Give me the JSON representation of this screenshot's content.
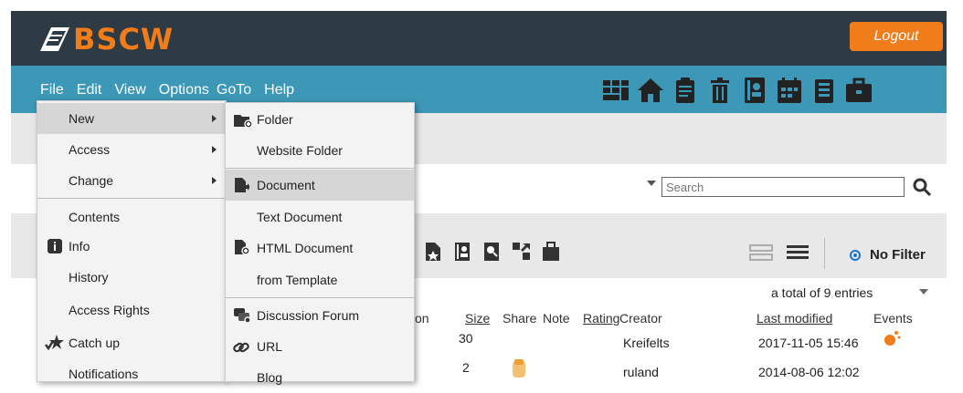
{
  "header": {
    "logo_text": "BSCW",
    "logout_label": "Logout"
  },
  "menubar": {
    "items": [
      "File",
      "Edit",
      "View",
      "Options",
      "GoTo",
      "Help"
    ]
  },
  "toolbar_icons": [
    "grid-icon",
    "home-icon",
    "clipboard-icon",
    "trash-icon",
    "contacts-icon",
    "calendar-icon",
    "tasks-icon",
    "briefcase-icon"
  ],
  "search": {
    "placeholder": "Search"
  },
  "filter": {
    "label": "No Filter"
  },
  "list": {
    "total": "a total of 9 entries",
    "headers": {
      "action": "on",
      "size": "Size",
      "share": "Share",
      "note": "Note",
      "rating": "Rating",
      "creator": "Creator",
      "modified": "Last modified",
      "events": "Events"
    },
    "rows": [
      {
        "size": "30",
        "creator": "Kreifelts",
        "modified": "2017-11-05 15:46"
      },
      {
        "size": "2",
        "creator": "ruland",
        "modified": "2014-08-06 12:02"
      }
    ]
  },
  "file_menu": {
    "items": [
      {
        "label": "New",
        "submenu": true,
        "icon": ""
      },
      {
        "label": "Access",
        "submenu": true,
        "icon": ""
      },
      {
        "label": "Change",
        "submenu": true,
        "icon": ""
      },
      {
        "label": "Contents",
        "submenu": false,
        "icon": ""
      },
      {
        "label": "Info",
        "submenu": false,
        "icon": "info-icon"
      },
      {
        "label": "History",
        "submenu": false,
        "icon": ""
      },
      {
        "label": "Access Rights",
        "submenu": false,
        "icon": ""
      },
      {
        "label": "Catch up",
        "submenu": false,
        "icon": "catch-up-icon"
      },
      {
        "label": "Notifications",
        "submenu": false,
        "icon": ""
      }
    ]
  },
  "new_submenu": {
    "items": [
      {
        "label": "Folder",
        "icon": "folder-icon"
      },
      {
        "label": "Website Folder",
        "icon": ""
      },
      {
        "label": "Document",
        "icon": "document-icon"
      },
      {
        "label": "Text Document",
        "icon": ""
      },
      {
        "label": "HTML Document",
        "icon": "html-document-icon"
      },
      {
        "label": "from Template",
        "icon": ""
      },
      {
        "label": "Discussion Forum",
        "icon": "forum-icon"
      },
      {
        "label": "URL",
        "icon": "url-icon"
      },
      {
        "label": "Blog",
        "icon": ""
      }
    ]
  },
  "colors": {
    "topbar": "#2e3a44",
    "accent": "#f07d1a",
    "menubar": "#3c98b6"
  }
}
